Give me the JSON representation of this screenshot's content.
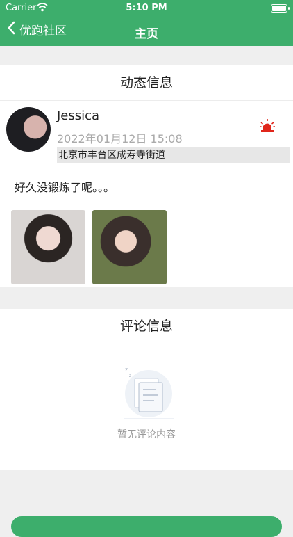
{
  "status_bar": {
    "carrier": "Carrier",
    "time": "5:10 PM"
  },
  "nav": {
    "back_label": "优跑社区",
    "title": "主页"
  },
  "post_section": {
    "title": "动态信息",
    "user_name": "Jessica",
    "post_time": "2022年01月12日  15:08",
    "location": "北京市丰台区成寿寺街道",
    "content": "好久没锻炼了呢。。。",
    "image_count": 2
  },
  "comments_section": {
    "title": "评论信息",
    "empty_text": "暂无评论内容"
  },
  "colors": {
    "primary_green": "#3dae6c",
    "alarm_red": "#e0261b"
  },
  "icons": {
    "back": "chevron-left-icon",
    "alarm": "siren-icon",
    "wifi": "wifi-icon",
    "battery": "battery-icon"
  }
}
